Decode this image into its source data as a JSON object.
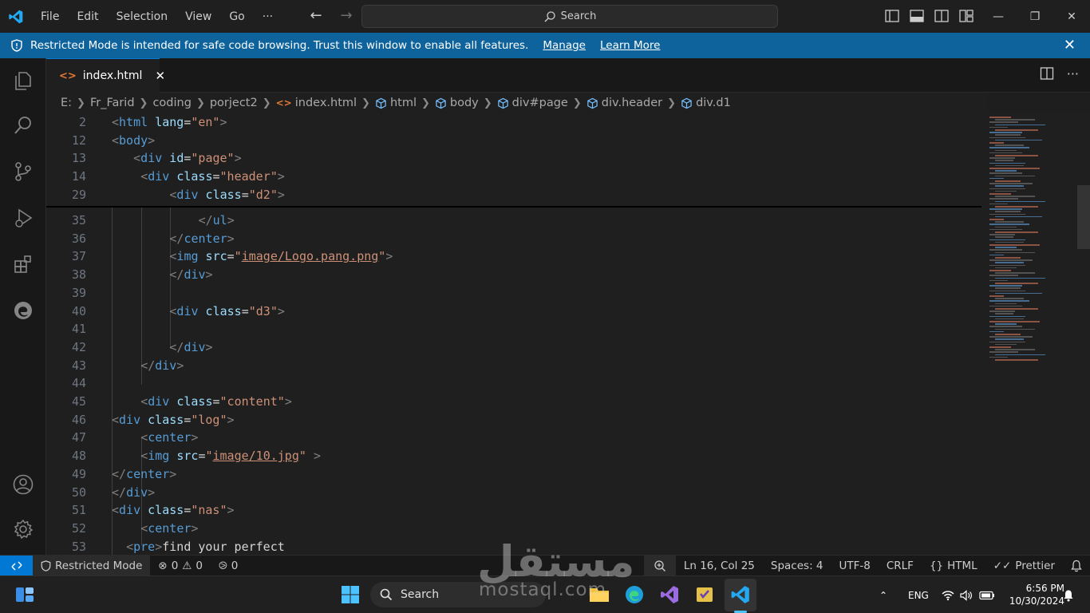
{
  "titlebar": {
    "menu": [
      "File",
      "Edit",
      "Selection",
      "View",
      "Go",
      "···"
    ],
    "search_label": "Search"
  },
  "banner": {
    "message": "Restricted Mode is intended for safe code browsing. Trust this window to enable all features.",
    "manage_label": "Manage",
    "learn_more_label": "Learn More"
  },
  "tab": {
    "filename": "index.html"
  },
  "breadcrumb": {
    "path": [
      "E:",
      "Fr_Farid",
      "coding",
      "porject2"
    ],
    "file": "index.html",
    "symbols": [
      "html",
      "body",
      "div#page",
      "div.header",
      "div.d1"
    ]
  },
  "editor": {
    "sticky": [
      {
        "ln": "2",
        "tokens": [
          [
            "t",
            "<"
          ],
          [
            "tn",
            "html"
          ],
          [
            "txt",
            " "
          ],
          [
            "at",
            "lang"
          ],
          [
            "txt",
            "="
          ],
          [
            "sv",
            "\"en\""
          ],
          [
            "t",
            ">"
          ]
        ],
        "indent": 0
      },
      {
        "ln": "12",
        "tokens": [
          [
            "t",
            "<"
          ],
          [
            "tn",
            "body"
          ],
          [
            "t",
            ">"
          ]
        ],
        "indent": 0
      },
      {
        "ln": "13",
        "tokens": [
          [
            "t",
            "<"
          ],
          [
            "tn",
            "div"
          ],
          [
            "txt",
            " "
          ],
          [
            "at",
            "id"
          ],
          [
            "txt",
            "="
          ],
          [
            "sv",
            "\"page\""
          ],
          [
            "t",
            ">"
          ]
        ],
        "indent": 3
      },
      {
        "ln": "14",
        "tokens": [
          [
            "t",
            "<"
          ],
          [
            "tn",
            "div"
          ],
          [
            "txt",
            " "
          ],
          [
            "at",
            "class"
          ],
          [
            "txt",
            "="
          ],
          [
            "sv",
            "\"header\""
          ],
          [
            "t",
            ">"
          ]
        ],
        "indent": 4
      },
      {
        "ln": "29",
        "tokens": [
          [
            "t",
            "<"
          ],
          [
            "tn",
            "div"
          ],
          [
            "txt",
            " "
          ],
          [
            "at",
            "class"
          ],
          [
            "txt",
            "="
          ],
          [
            "sv",
            "\"d2\""
          ],
          [
            "t",
            ">"
          ]
        ],
        "indent": 8
      }
    ],
    "lines": [
      {
        "ln": "35",
        "tokens": [
          [
            "t",
            "</"
          ],
          [
            "tn",
            "ul"
          ],
          [
            "t",
            ">"
          ]
        ],
        "indent": 12
      },
      {
        "ln": "36",
        "tokens": [
          [
            "t",
            "</"
          ],
          [
            "tn",
            "center"
          ],
          [
            "t",
            ">"
          ]
        ],
        "indent": 8
      },
      {
        "ln": "37",
        "tokens": [
          [
            "t",
            "<"
          ],
          [
            "tn",
            "img"
          ],
          [
            "txt",
            " "
          ],
          [
            "at",
            "src"
          ],
          [
            "txt",
            "="
          ],
          [
            "sv",
            "\""
          ],
          [
            "svu",
            "image/Logo.pang.png"
          ],
          [
            "sv",
            "\""
          ],
          [
            "t",
            ">"
          ]
        ],
        "indent": 8
      },
      {
        "ln": "38",
        "tokens": [
          [
            "t",
            "</"
          ],
          [
            "tn",
            "div"
          ],
          [
            "t",
            ">"
          ]
        ],
        "indent": 8
      },
      {
        "ln": "39",
        "tokens": [],
        "indent": 0
      },
      {
        "ln": "40",
        "tokens": [
          [
            "t",
            "<"
          ],
          [
            "tn",
            "div"
          ],
          [
            "txt",
            " "
          ],
          [
            "at",
            "class"
          ],
          [
            "txt",
            "="
          ],
          [
            "sv",
            "\"d3\""
          ],
          [
            "t",
            ">"
          ]
        ],
        "indent": 8
      },
      {
        "ln": "41",
        "tokens": [],
        "indent": 0
      },
      {
        "ln": "42",
        "tokens": [
          [
            "t",
            "</"
          ],
          [
            "tn",
            "div"
          ],
          [
            "t",
            ">"
          ]
        ],
        "indent": 8
      },
      {
        "ln": "43",
        "tokens": [
          [
            "t",
            "</"
          ],
          [
            "tn",
            "div"
          ],
          [
            "t",
            ">"
          ]
        ],
        "indent": 4
      },
      {
        "ln": "44",
        "tokens": [],
        "indent": 0
      },
      {
        "ln": "45",
        "tokens": [
          [
            "t",
            "<"
          ],
          [
            "tn",
            "div"
          ],
          [
            "txt",
            " "
          ],
          [
            "at",
            "class"
          ],
          [
            "txt",
            "="
          ],
          [
            "sv",
            "\"content\""
          ],
          [
            "t",
            ">"
          ]
        ],
        "indent": 4
      },
      {
        "ln": "46",
        "tokens": [
          [
            "t",
            "<"
          ],
          [
            "tn",
            "div"
          ],
          [
            "txt",
            " "
          ],
          [
            "at",
            "class"
          ],
          [
            "txt",
            "="
          ],
          [
            "sv",
            "\"log\""
          ],
          [
            "t",
            ">"
          ]
        ],
        "indent": 0
      },
      {
        "ln": "47",
        "tokens": [
          [
            "t",
            "<"
          ],
          [
            "tn",
            "center"
          ],
          [
            "t",
            ">"
          ]
        ],
        "indent": 4
      },
      {
        "ln": "48",
        "tokens": [
          [
            "t",
            "<"
          ],
          [
            "tn",
            "img"
          ],
          [
            "txt",
            " "
          ],
          [
            "at",
            "src"
          ],
          [
            "txt",
            "="
          ],
          [
            "sv",
            "\""
          ],
          [
            "svu",
            "image/10.jpg"
          ],
          [
            "sv",
            "\""
          ],
          [
            "txt",
            " "
          ],
          [
            "t",
            ">"
          ]
        ],
        "indent": 4
      },
      {
        "ln": "49",
        "tokens": [
          [
            "t",
            "</"
          ],
          [
            "tn",
            "center"
          ],
          [
            "t",
            ">"
          ]
        ],
        "indent": 0
      },
      {
        "ln": "50",
        "tokens": [
          [
            "t",
            "</"
          ],
          [
            "tn",
            "div"
          ],
          [
            "t",
            ">"
          ]
        ],
        "indent": 0
      },
      {
        "ln": "51",
        "tokens": [
          [
            "t",
            "<"
          ],
          [
            "tn",
            "div"
          ],
          [
            "txt",
            " "
          ],
          [
            "at",
            "class"
          ],
          [
            "txt",
            "="
          ],
          [
            "sv",
            "\"nas\""
          ],
          [
            "t",
            ">"
          ]
        ],
        "indent": 0
      },
      {
        "ln": "52",
        "tokens": [
          [
            "t",
            "<"
          ],
          [
            "tn",
            "center"
          ],
          [
            "t",
            ">"
          ]
        ],
        "indent": 4
      },
      {
        "ln": "53",
        "tokens": [
          [
            "t",
            "<"
          ],
          [
            "tn",
            "pre"
          ],
          [
            "t",
            ">"
          ],
          [
            "txt",
            "find your perfect"
          ]
        ],
        "indent": 2
      }
    ]
  },
  "statusbar": {
    "restricted": "Restricted Mode",
    "errors": "0",
    "warnings": "0",
    "ports": "0",
    "position": "Ln 16, Col 25",
    "spaces": "Spaces: 4",
    "encoding": "UTF-8",
    "eol": "CRLF",
    "language": "HTML",
    "formatter": "Prettier"
  },
  "taskbar": {
    "search_label": "Search",
    "lang": "ENG",
    "time": "6:56 PM",
    "date": "10/30/2024"
  },
  "watermark": {
    "arabic": "مستقل",
    "latin": "mostaql.com"
  },
  "colors": {
    "banner": "#0e639c",
    "accent": "#0078d4",
    "tag": "#569cd6",
    "attr": "#9cdcfe",
    "string": "#ce9178"
  }
}
